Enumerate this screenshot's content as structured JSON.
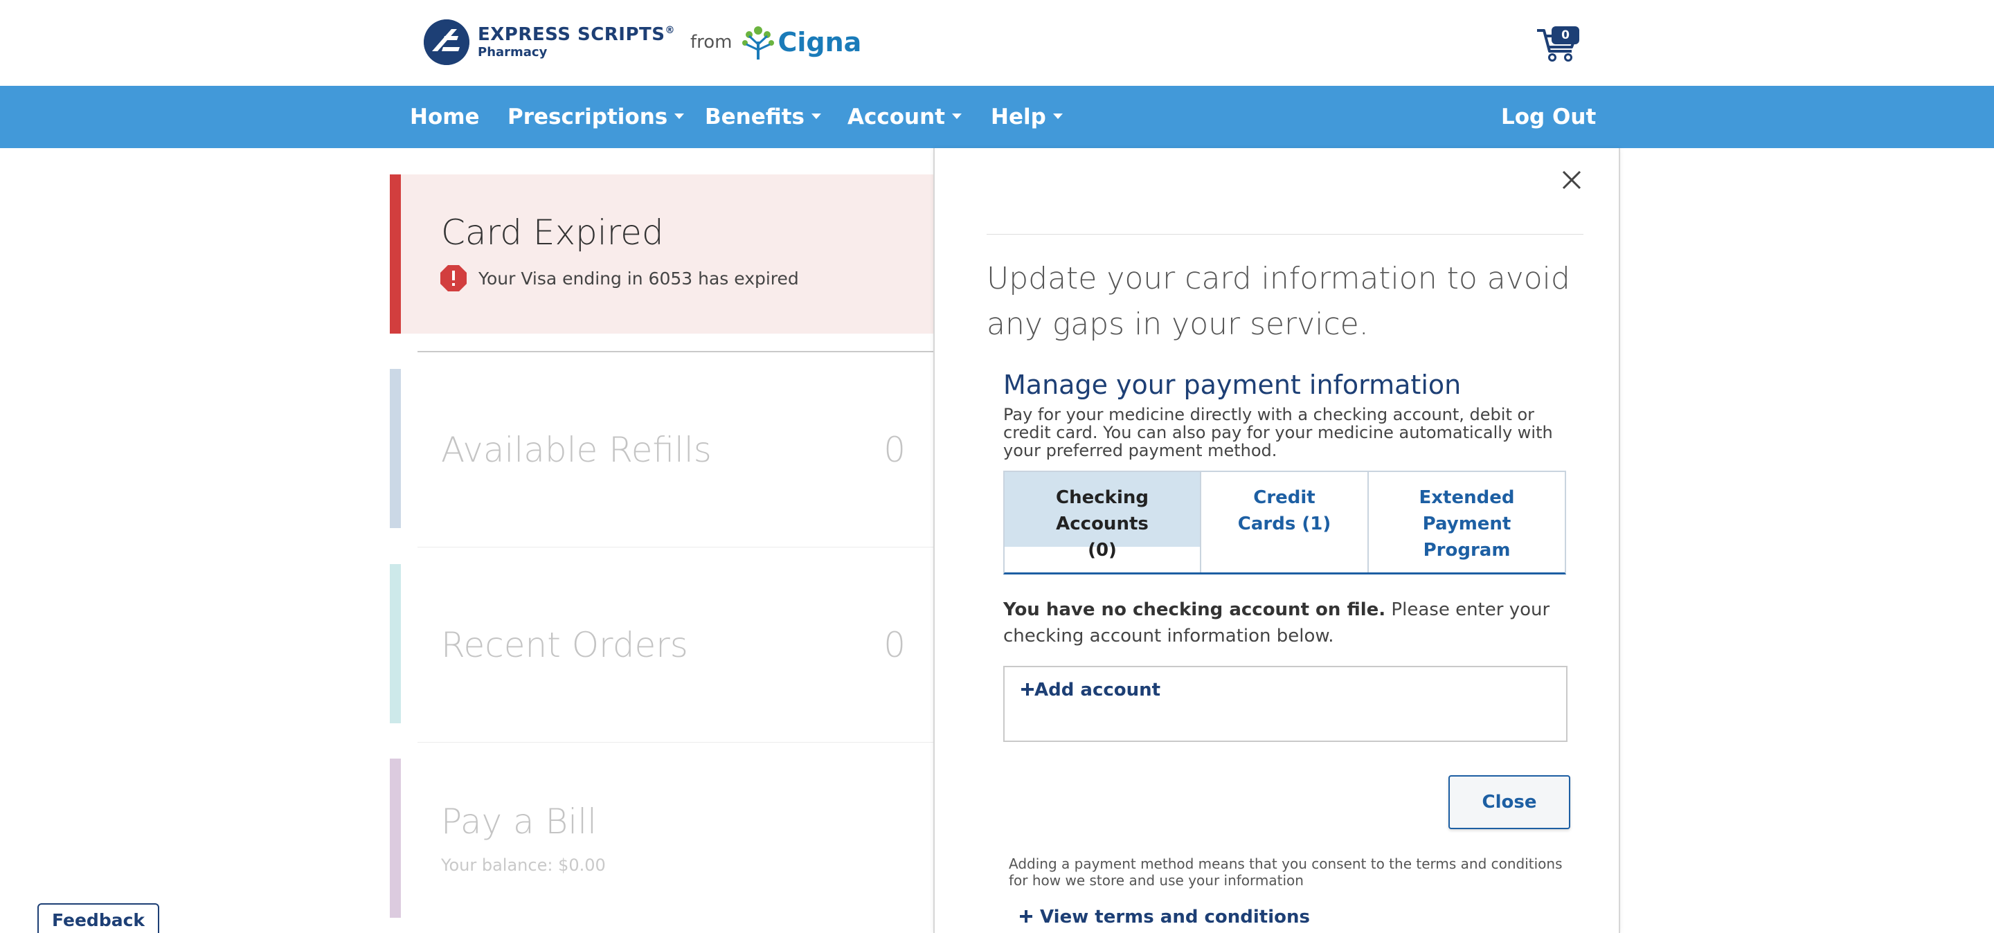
{
  "header": {
    "brand_line1": "EXPRESS SCRIPTS",
    "brand_registered": "®",
    "brand_line2": "Pharmacy",
    "from": "from",
    "partner": "Cigna",
    "cart_count": "0"
  },
  "nav": {
    "home": "Home",
    "prescriptions": "Prescriptions",
    "benefits": "Benefits",
    "account": "Account",
    "help": "Help",
    "logout": "Log Out"
  },
  "dashboard": {
    "expired_title": "Card Expired",
    "expired_message": "Your Visa ending in 6053 has expired",
    "refills_label": "Available Refills",
    "refills_count": "0",
    "orders_label": "Recent Orders",
    "orders_count": "0",
    "bill_label": "Pay a Bill",
    "bill_balance": "Your balance: $0.00"
  },
  "panel": {
    "headline": "Update your card information to avoid any gaps in your service.",
    "manage_title": "Manage your payment information",
    "manage_desc": "Pay for your medicine directly with a checking account, debit or credit card. You can also pay for your medicine automatically with your preferred payment method.",
    "tabs": [
      {
        "label": "Checking Accounts (0)"
      },
      {
        "label": "Credit Cards (1)"
      },
      {
        "label": "Extended Payment Program"
      }
    ],
    "no_account_bold": "You have no checking account on file.",
    "no_account_rest": " Please enter your checking account information below.",
    "add_account": "Add account",
    "close_button": "Close",
    "consent": "Adding a payment method means that you consent to the terms and conditions for how we store and use your information",
    "terms_link": "View terms and conditions"
  },
  "feedback": "Feedback",
  "colors": {
    "nav": "#4299d9",
    "brand_navy": "#1d3f75",
    "alert_red": "#d23e3e",
    "expired_bg": "#f9eceb",
    "link_blue": "#1d5fa3"
  }
}
